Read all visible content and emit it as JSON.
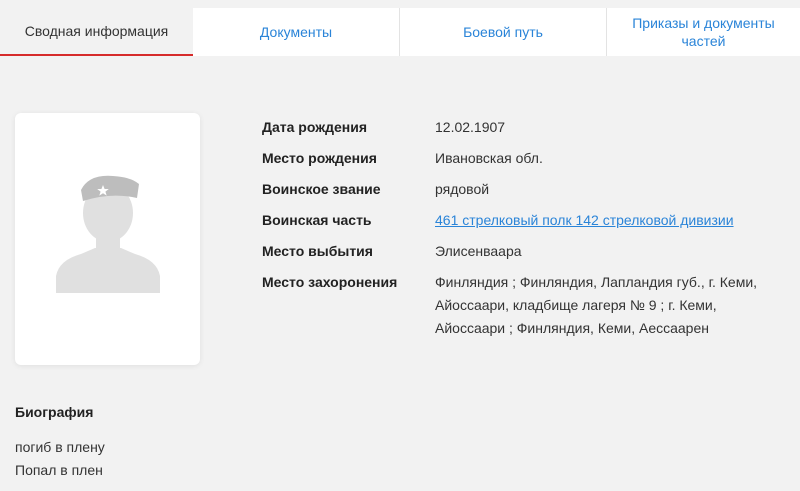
{
  "tabs": [
    {
      "label": "Сводная информация",
      "active": true
    },
    {
      "label": "Документы",
      "active": false
    },
    {
      "label": "Боевой путь",
      "active": false
    },
    {
      "label": "Приказы и документы частей",
      "active": false
    }
  ],
  "photo": {
    "icon": "soldier-silhouette-icon"
  },
  "info": {
    "birth_date_label": "Дата рождения",
    "birth_date": "12.02.1907",
    "birth_place_label": "Место рождения",
    "birth_place": "Ивановская обл.",
    "rank_label": "Воинское звание",
    "rank": "рядовой",
    "unit_label": "Воинская часть",
    "unit": "461 стрелковый полк 142 стрелковой дивизии",
    "departure_label": "Место выбытия",
    "departure": "Элисенваара",
    "burial_label": "Место захоронения",
    "burial": "Финляндия ; Финляндия, Лапландия губ., г. Кеми, Айоссаари, кладбище лагеря № 9 ; г. Кеми, Айоссаари ; Финляндия, Кеми, Аессаарен"
  },
  "biography": {
    "title": "Биография",
    "lines": [
      "погиб в плену",
      "Попал в плен"
    ]
  },
  "colors": {
    "accent_red": "#d62b2b",
    "link_blue": "#2a84d8"
  }
}
